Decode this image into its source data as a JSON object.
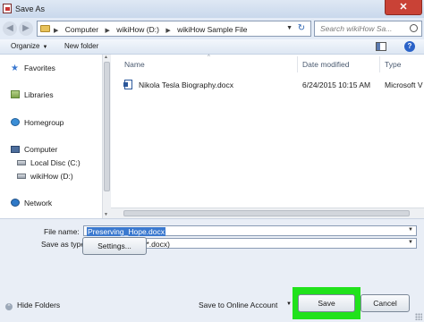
{
  "window": {
    "title": "Save As",
    "close_glyph": "✕"
  },
  "address": {
    "back_glyph": "◀",
    "forward_glyph": "▶",
    "breadcrumbs": [
      "Computer",
      "wikiHow (D:)",
      "wikiHow Sample File"
    ],
    "crumb_sep": "▶",
    "dropdown_glyph": "▼",
    "refresh_glyph": "↻",
    "search_placeholder": "Search wikiHow Sa..."
  },
  "toolbar": {
    "organize_label": "Organize",
    "organize_dd": "▼",
    "new_folder_label": "New folder",
    "help_glyph": "?"
  },
  "nav_pane": {
    "items": [
      {
        "label": "Favorites",
        "icon": "star-icon"
      },
      {
        "label": "Libraries",
        "icon": "libraries-icon"
      },
      {
        "label": "Homegroup",
        "icon": "homegroup-icon"
      },
      {
        "label": "Computer",
        "icon": "computer-icon"
      },
      {
        "label": "Local Disc (C:)",
        "icon": "disk-icon"
      },
      {
        "label": "wikiHow (D:)",
        "icon": "disk-icon"
      },
      {
        "label": "Network",
        "icon": "network-icon"
      }
    ],
    "star_glyph": "★"
  },
  "file_list": {
    "columns": [
      "Name",
      "Date modified",
      "Type"
    ],
    "sort_glyph": "^",
    "rows": [
      {
        "name": "Nikola Tesla Biography.docx",
        "date": "6/24/2015 10:15 AM",
        "type": "Microsoft V"
      }
    ]
  },
  "form": {
    "file_name_label": "File name:",
    "file_name_value": "Preserving_Hope.docx",
    "save_as_type_label": "Save as type:",
    "save_as_type_value": "Word Document (*.docx)",
    "dd_glyph": "▼",
    "settings_label": "Settings...",
    "hide_folders_label": "Hide Folders",
    "hide_folders_glyph": "^",
    "save_online_label": "Save to Online Account",
    "save_label": "Save",
    "cancel_label": "Cancel"
  },
  "colors": {
    "highlight": "#21e21b",
    "selection": "#3b79cf",
    "close": "#c94236"
  }
}
